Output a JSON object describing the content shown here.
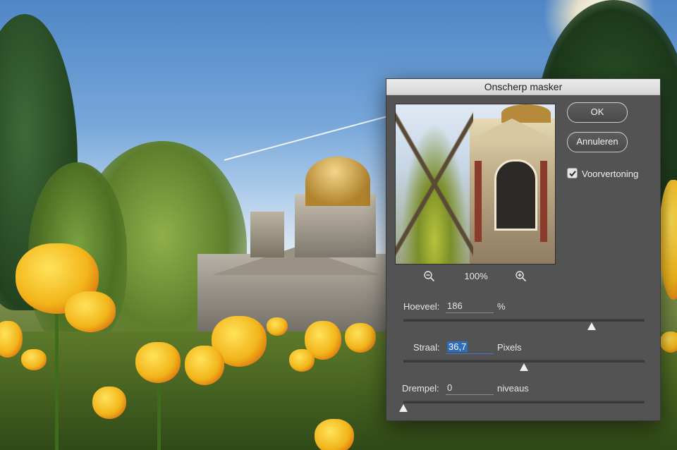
{
  "dialog": {
    "title": "Onscherp masker",
    "buttons": {
      "ok": "OK",
      "cancel": "Annuleren"
    },
    "preview_checkbox": {
      "label": "Voorvertoning",
      "checked": true
    },
    "zoom": {
      "level": "100%",
      "zoom_out_icon": "zoom-out-icon",
      "zoom_in_icon": "zoom-in-icon"
    },
    "params": {
      "amount": {
        "label": "Hoeveel:",
        "value": "186",
        "unit": "%",
        "min": 1,
        "max": 500,
        "slider": 186
      },
      "radius": {
        "label": "Straal:",
        "value": "36,7",
        "unit": "Pixels",
        "min": 0.1,
        "max": 1000,
        "slider": 36.7,
        "focused": true
      },
      "threshold": {
        "label": "Drempel:",
        "value": "0",
        "unit": "niveaus",
        "min": 0,
        "max": 255,
        "slider": 0
      }
    },
    "slider_positions": {
      "amount": 0.78,
      "radius": 0.5,
      "threshold": 0.0
    }
  },
  "colors": {
    "dialog_bg": "#535353",
    "selection": "#2f6dbd",
    "titlebar": "#e4e4e4"
  }
}
